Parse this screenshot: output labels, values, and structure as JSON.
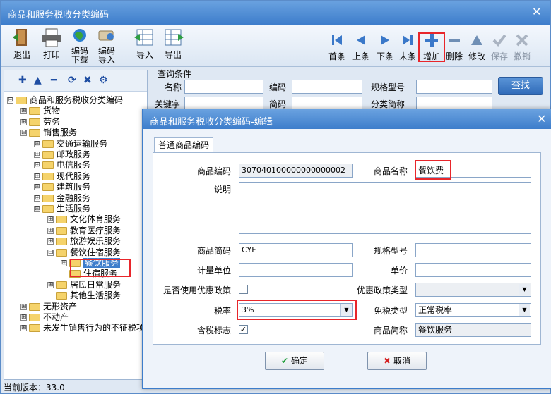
{
  "window": {
    "title": "商品和服务税收分类编码",
    "close": "✕"
  },
  "toolbar": {
    "exit": "退出",
    "print": "打印",
    "code_download_1": "编码",
    "code_download_2": "下载",
    "code_import_1": "编码",
    "code_import_2": "导入",
    "import": "导入",
    "export": "导出",
    "first": "首条",
    "prev": "上条",
    "next": "下条",
    "last": "末条",
    "add": "增加",
    "delete": "删除",
    "modify": "修改",
    "save": "保存",
    "cancel": "撤销"
  },
  "tree_tools": [
    "✚",
    "▲",
    "━",
    "⟳",
    "✖",
    "⚙"
  ],
  "tree": [
    {
      "label": "商品和服务税收分类编码",
      "pm": "⊟",
      "level": 0
    },
    {
      "label": "货物",
      "pm": "⊞",
      "level": 1
    },
    {
      "label": "劳务",
      "pm": "⊞",
      "level": 1
    },
    {
      "label": "销售服务",
      "pm": "⊟",
      "level": 1
    },
    {
      "label": "交通运输服务",
      "pm": "⊞",
      "level": 2
    },
    {
      "label": "邮政服务",
      "pm": "⊞",
      "level": 2
    },
    {
      "label": "电信服务",
      "pm": "⊞",
      "level": 2
    },
    {
      "label": "现代服务",
      "pm": "⊞",
      "level": 2
    },
    {
      "label": "建筑服务",
      "pm": "⊞",
      "level": 2
    },
    {
      "label": "金融服务",
      "pm": "⊞",
      "level": 2
    },
    {
      "label": "生活服务",
      "pm": "⊟",
      "level": 2
    },
    {
      "label": "文化体育服务",
      "pm": "⊞",
      "level": 3
    },
    {
      "label": "教育医疗服务",
      "pm": "⊞",
      "level": 3
    },
    {
      "label": "旅游娱乐服务",
      "pm": "⊞",
      "level": 3
    },
    {
      "label": "餐饮住宿服务",
      "pm": "⊟",
      "level": 3
    },
    {
      "label": "餐饮服务",
      "pm": "⊞",
      "level": 4
    },
    {
      "label": "住宿服务",
      "pm": "",
      "level": 4
    },
    {
      "label": "居民日常服务",
      "pm": "⊞",
      "level": 3
    },
    {
      "label": "其他生活服务",
      "pm": "",
      "level": 3
    },
    {
      "label": "无形资产",
      "pm": "⊞",
      "level": 1
    },
    {
      "label": "不动产",
      "pm": "⊞",
      "level": 1
    },
    {
      "label": "未发生销售行为的不征税项目",
      "pm": "⊞",
      "level": 1
    }
  ],
  "status": "当前版本：33.0",
  "query": {
    "legend": "查询条件",
    "name_label": "名称",
    "code_label": "编码",
    "spec_label": "规格型号",
    "keyword_label": "关键字",
    "code2_label": "简码",
    "short_label": "分类简称",
    "find": "查找"
  },
  "dialog": {
    "title": "商品和服务税收分类编码-编辑",
    "close": "✕",
    "tab": "普通商品编码",
    "code_label": "商品编码",
    "code_value": "307040100000000000002",
    "name_label": "商品名称",
    "name_value": "餐饮费",
    "desc_label": "说明",
    "desc_value": "",
    "abbr_label": "商品简码",
    "abbr_value": "CYF",
    "spec_label": "规格型号",
    "spec_value": "",
    "unit_label": "计量单位",
    "unit_value": "",
    "price_label": "单价",
    "price_value": "",
    "pref_label": "是否使用优惠政策",
    "pref_checked": "",
    "pref_type_label": "优惠政策类型",
    "pref_type_value": "",
    "tax_rate_label": "税率",
    "tax_rate_value": "3%",
    "exempt_label": "免税类型",
    "exempt_value": "正常税率",
    "tax_incl_label": "含税标志",
    "tax_incl_checked": "✓",
    "short_name_label": "商品简称",
    "short_name_value": "餐饮服务",
    "ok": "确定",
    "cancel": "取消"
  }
}
